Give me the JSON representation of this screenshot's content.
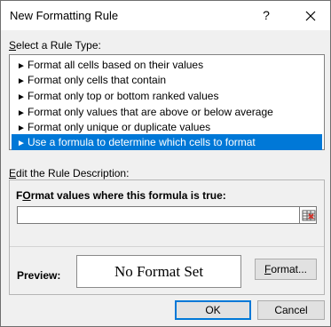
{
  "window": {
    "title": "New Formatting Rule",
    "help_label": "?"
  },
  "rule_type": {
    "label_prefix": "S",
    "label_rest": "elect a Rule Type:",
    "arrow_glyph": "►",
    "items": [
      {
        "label": "Format all cells based on their values",
        "selected": false
      },
      {
        "label": "Format only cells that contain",
        "selected": false
      },
      {
        "label": "Format only top or bottom ranked values",
        "selected": false
      },
      {
        "label": "Format only values that are above or below average",
        "selected": false
      },
      {
        "label": "Format only unique or duplicate values",
        "selected": false
      },
      {
        "label": "Use a formula to determine which cells to format",
        "selected": true
      }
    ]
  },
  "description": {
    "label_prefix": "E",
    "label_rest": "dit the Rule Description:",
    "formula_label_prefix": "O",
    "formula_label_start": "F",
    "formula_label_rest": "rmat values where this formula is true:",
    "formula_value": "",
    "preview_label": "Preview:",
    "preview_text": "No Format Set",
    "format_button_prefix": "F",
    "format_button_rest": "ormat..."
  },
  "buttons": {
    "ok": "OK",
    "cancel": "Cancel"
  },
  "colors": {
    "selection": "#0078d7",
    "dialog_bg": "#f0f0f0"
  }
}
